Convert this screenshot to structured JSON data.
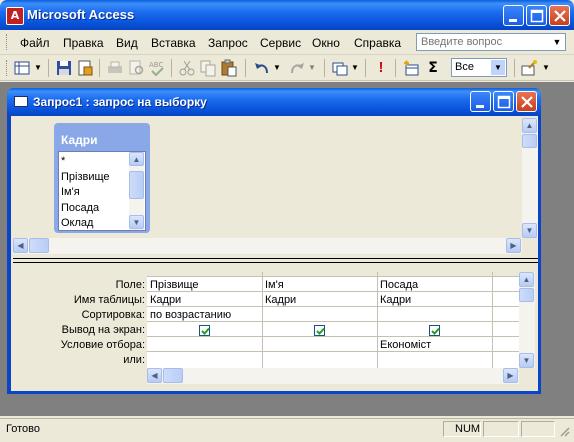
{
  "app": {
    "title": "Microsoft Access",
    "icon_glyph": "A"
  },
  "menubar": {
    "items": [
      "Файл",
      "Правка",
      "Вид",
      "Вставка",
      "Запрос",
      "Сервис",
      "Окно",
      "Справка"
    ],
    "help_placeholder": "Введите вопрос"
  },
  "toolbar": {
    "zoom_value": "Все",
    "icons": [
      "view-icon",
      "save-icon",
      "properties-icon",
      "print-icon",
      "print-preview-icon",
      "spelling-icon",
      "cut-icon",
      "copy-icon",
      "paste-icon",
      "undo-icon",
      "redo-icon",
      "query-type-icon",
      "run-icon",
      "show-table-icon",
      "totals-icon",
      "zoom-select",
      "build-icon"
    ]
  },
  "query_window": {
    "title": "Запрос1 : запрос на выборку"
  },
  "table_box": {
    "title": "Кадри",
    "fields": [
      "*",
      "Прізвище",
      "Ім'я",
      "Посада",
      "Оклад"
    ]
  },
  "grid": {
    "row_labels": [
      "Поле:",
      "Имя таблицы:",
      "Сортировка:",
      "Вывод на экран:",
      "Условие отбора:",
      "или:"
    ],
    "columns": [
      {
        "field": "Прізвище",
        "table": "Кадри",
        "sort": "по возрастанию",
        "show": true,
        "criteria": "",
        "or": ""
      },
      {
        "field": "Ім'я",
        "table": "Кадри",
        "sort": "",
        "show": true,
        "criteria": "",
        "or": ""
      },
      {
        "field": "Посада",
        "table": "Кадри",
        "sort": "",
        "show": true,
        "criteria": "Економіст",
        "or": ""
      }
    ]
  },
  "status": {
    "text": "Готово",
    "num": "NUM"
  },
  "colors": {
    "titlebar": "#0a5fe0",
    "chrome": "#ece9d8",
    "workspace": "#808080",
    "tablebox": "#8aa8e8"
  }
}
